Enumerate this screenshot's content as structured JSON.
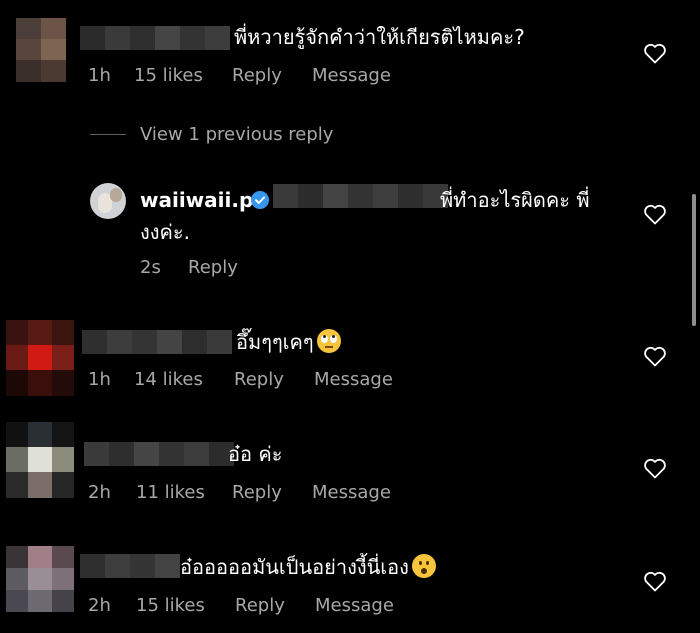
{
  "comments": [
    {
      "text": "พี่หวายรู้จักคำว่าให้เกียรติไหมคะ?",
      "time": "1h",
      "likes": "15 likes",
      "reply": "Reply",
      "message": "Message"
    },
    {
      "text": "อึ๊มๆๆเคๆ",
      "time": "1h",
      "likes": "14 likes",
      "reply": "Reply",
      "message": "Message"
    },
    {
      "text": "อ๋อ ค่ะ",
      "time": "2h",
      "likes": "11 likes",
      "reply": "Reply",
      "message": "Message"
    },
    {
      "text": "อ๋อออออมันเป็นอย่างงี้นี่เอง",
      "time": "2h",
      "likes": "15 likes",
      "reply": "Reply",
      "message": "Message"
    }
  ],
  "view_replies": "View 1 previous reply",
  "reply": {
    "username": "waiiwaii.p",
    "text_line1": "พี่ทำอะไรผิดคะ พี่",
    "text_line2": "งงค่ะ.",
    "time": "2s",
    "reply_label": "Reply"
  },
  "colors": {
    "background": "#000000",
    "text": "#ffffff",
    "meta": "#a8a8a8",
    "verified": "#3797f0"
  }
}
